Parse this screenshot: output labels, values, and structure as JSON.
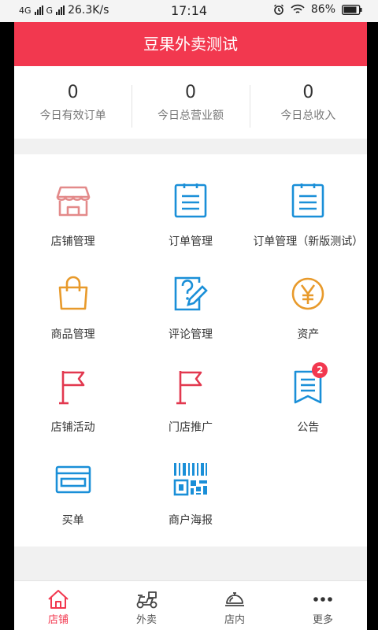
{
  "status_bar": {
    "network1": "4G",
    "network2": "G",
    "speed": "26.3K/s",
    "time": "17:14",
    "battery": "86%"
  },
  "header": {
    "title": "豆果外卖测试"
  },
  "stats": [
    {
      "value": "0",
      "label": "今日有效订单"
    },
    {
      "value": "0",
      "label": "今日总营业额"
    },
    {
      "value": "0",
      "label": "今日总收入"
    }
  ],
  "menu": [
    {
      "label": "店铺管理",
      "icon": "store-icon"
    },
    {
      "label": "订单管理",
      "icon": "order-list-icon"
    },
    {
      "label": "订单管理（新版测试）",
      "icon": "order-list-icon"
    },
    {
      "label": "商品管理",
      "icon": "shopping-bag-icon"
    },
    {
      "label": "评论管理",
      "icon": "review-edit-icon"
    },
    {
      "label": "资产",
      "icon": "yen-coin-icon"
    },
    {
      "label": "店铺活动",
      "icon": "flag-icon"
    },
    {
      "label": "门店推广",
      "icon": "flag-icon"
    },
    {
      "label": "公告",
      "icon": "notice-icon",
      "badge": "2"
    },
    {
      "label": "买单",
      "icon": "card-icon"
    },
    {
      "label": "商户海报",
      "icon": "qr-code-icon"
    }
  ],
  "tabs": [
    {
      "label": "店铺",
      "icon": "home-icon",
      "active": true
    },
    {
      "label": "外卖",
      "icon": "scooter-icon"
    },
    {
      "label": "店内",
      "icon": "cloche-icon"
    },
    {
      "label": "更多",
      "icon": "more-icon"
    }
  ],
  "colors": {
    "brand": "#f2384f",
    "blue": "#1a8fd8",
    "orange": "#e89a2b",
    "pink": "#e38a8a"
  }
}
